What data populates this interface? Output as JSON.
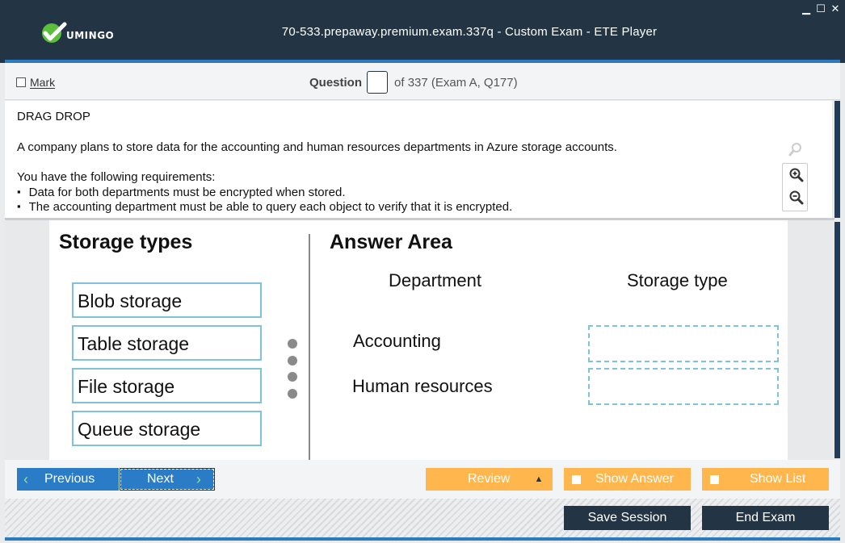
{
  "app": {
    "logo_text": "UMINGO",
    "title": "70-533.prepaway.premium.exam.337q - Custom Exam - ETE Player",
    "window_controls": [
      "minimize-icon",
      "maximize-icon",
      "close-icon"
    ]
  },
  "question_bar": {
    "mark_label": "Mark",
    "question_label": "Question",
    "question_input_value": "",
    "of_text": "of 337 (Exam A, Q177)"
  },
  "question": {
    "type_label": "DRAG DROP",
    "intro": "A company plans to store data for the accounting and human resources departments in Azure storage accounts.",
    "requirements_intro": "You have the following requirements:",
    "requirements": [
      "Data for both departments must be encrypted when stored.",
      "The accounting department must be able to query each object to verify that it is encrypted."
    ]
  },
  "exhibit": {
    "left_heading": "Storage types",
    "right_heading": "Answer Area",
    "storage_types": [
      "Blob storage",
      "Table storage",
      "File storage",
      "Queue storage"
    ],
    "column_department": "Department",
    "column_storage_type": "Storage type",
    "rows": [
      "Accounting",
      "Human resources"
    ]
  },
  "nav": {
    "previous_label": "Previous",
    "next_label": "Next",
    "review_label": "Review",
    "show_answer_label": "Show Answer",
    "show_list_label": "Show List"
  },
  "footer": {
    "save_session_label": "Save Session",
    "end_exam_label": "End Exam"
  },
  "colors": {
    "titlebar": "#233444",
    "accent_blue": "#2b7bbd",
    "button_blue": "#2b7cc7",
    "button_orange": "#ffb74d",
    "dropzone_border": "#7ec2dc"
  }
}
